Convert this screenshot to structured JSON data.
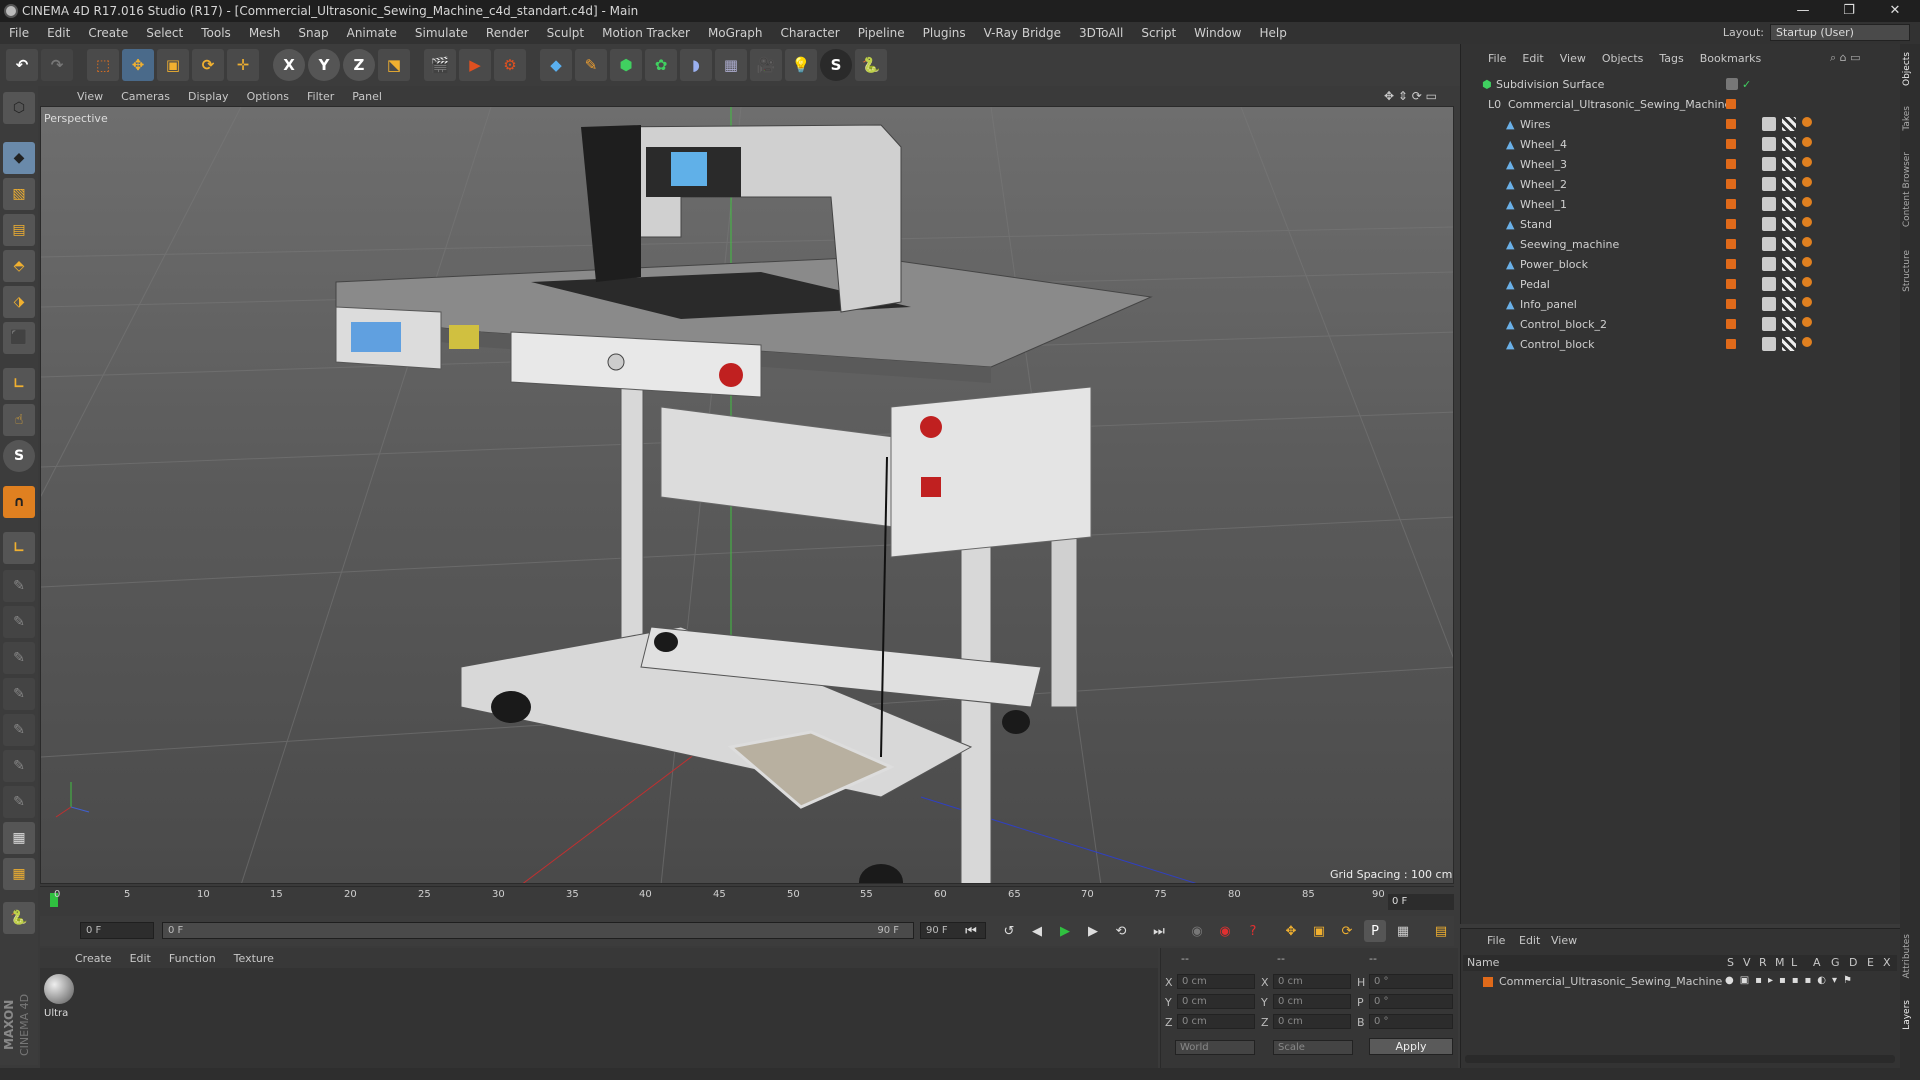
{
  "window": {
    "title": "CINEMA 4D R17.016 Studio (R17) - [Commercial_Ultrasonic_Sewing_Machine_c4d_standart.c4d] - Main",
    "minimize": "—",
    "restore": "❐",
    "close": "✕"
  },
  "menubar": {
    "items": [
      "File",
      "Edit",
      "Create",
      "Select",
      "Tools",
      "Mesh",
      "Snap",
      "Animate",
      "Simulate",
      "Render",
      "Sculpt",
      "Motion Tracker",
      "MoGraph",
      "Character",
      "Pipeline",
      "Plugins",
      "V-Ray Bridge",
      "3DToAll",
      "Script",
      "Window",
      "Help"
    ],
    "layout_label": "Layout:",
    "layout_value": "Startup (User)"
  },
  "viewport": {
    "menu": [
      "View",
      "Cameras",
      "Display",
      "Options",
      "Filter",
      "Panel"
    ],
    "label": "Perspective",
    "grid_spacing": "Grid Spacing : 100 cm"
  },
  "timeline": {
    "ticks": [
      "0",
      "5",
      "10",
      "15",
      "20",
      "25",
      "30",
      "35",
      "40",
      "45",
      "50",
      "55",
      "60",
      "65",
      "70",
      "75",
      "80",
      "85",
      "90"
    ],
    "frame_display": "0 F"
  },
  "transport": {
    "start_frame": "0 F",
    "range_start": "0 F",
    "range_end": "90 F",
    "end_frame": "90 F"
  },
  "materials": {
    "menu": [
      "Create",
      "Edit",
      "Function",
      "Texture"
    ],
    "item_label": "Ultra"
  },
  "coordinates": {
    "header_left": "--",
    "header_mid": "--",
    "header_right": "--",
    "rows": [
      {
        "axis": "X",
        "pos": "0 cm",
        "axis2": "X",
        "size": "0 cm",
        "rot_axis": "H",
        "rot": "0 °"
      },
      {
        "axis": "Y",
        "pos": "0 cm",
        "axis2": "Y",
        "size": "0 cm",
        "rot_axis": "P",
        "rot": "0 °"
      },
      {
        "axis": "Z",
        "pos": "0 cm",
        "axis2": "Z",
        "size": "0 cm",
        "rot_axis": "B",
        "rot": "0 °"
      }
    ],
    "mode_world": "World",
    "mode_scale": "Scale",
    "apply": "Apply"
  },
  "object_manager": {
    "menu": [
      "File",
      "Edit",
      "View",
      "Objects",
      "Tags",
      "Bookmarks"
    ],
    "root": "Subdivision Surface",
    "parent": "Commercial_Ultrasonic_Sewing_Machine",
    "children": [
      "Wires",
      "Wheel_4",
      "Wheel_3",
      "Wheel_2",
      "Wheel_1",
      "Stand",
      "Seewing_machine",
      "Power_block",
      "Pedal",
      "Info_panel",
      "Control_block_2",
      "Control_block"
    ]
  },
  "layer_manager": {
    "menu": [
      "File",
      "Edit",
      "View"
    ],
    "col_name": "Name",
    "cols": [
      "S",
      "V",
      "R",
      "M",
      "L",
      "A",
      "G",
      "D",
      "E",
      "X"
    ],
    "row": "Commercial_Ultrasonic_Sewing_Machine"
  },
  "side_tabs": [
    "Objects",
    "Takes",
    "Content Browser",
    "Structure",
    "Attributes",
    "Layers"
  ],
  "logo": {
    "maxon": "MAXON",
    "product": "CINEMA 4D"
  },
  "colors": {
    "accent_orange": "#e06a1a",
    "viewport_bg": "#656565",
    "panel": "#333333"
  }
}
